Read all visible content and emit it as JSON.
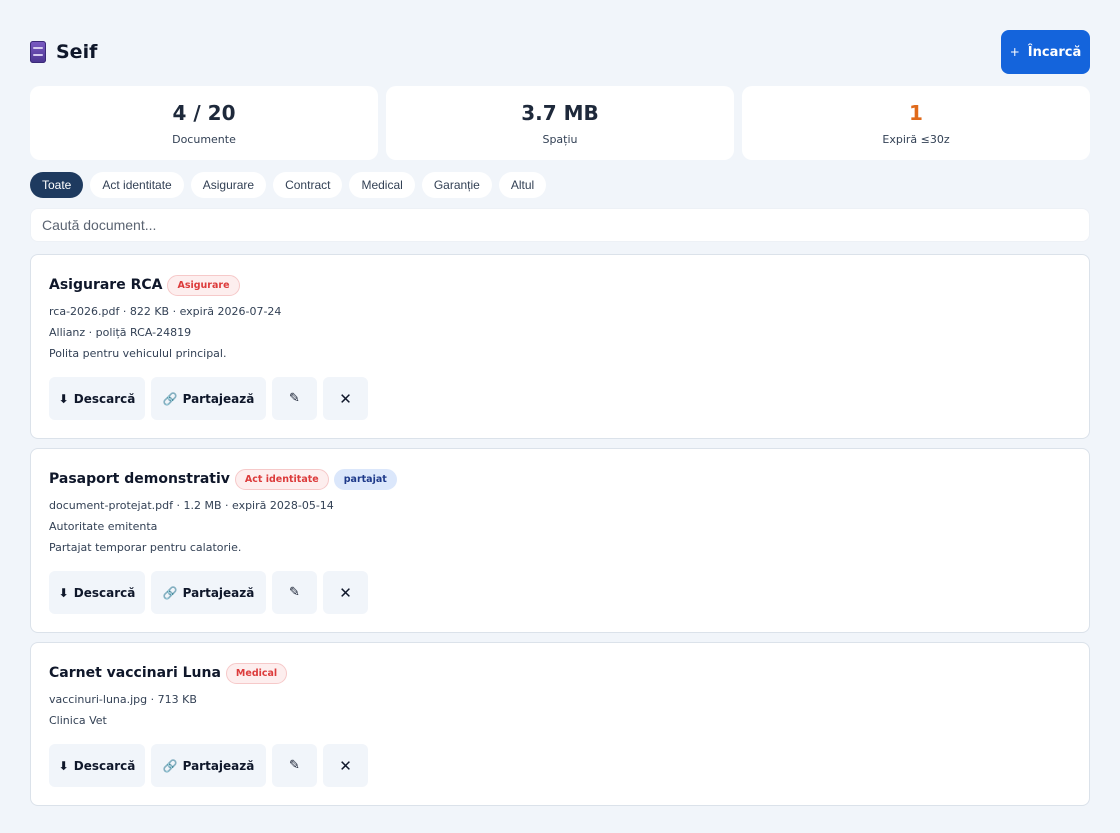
{
  "header": {
    "title": "Seif",
    "upload_label": "Încarcă",
    "upload_icon": "plus-icon",
    "vault_icon": "vault-icon"
  },
  "stats": [
    {
      "value": "4 / 20",
      "label": "Documente"
    },
    {
      "value": "3.7 MB",
      "label": "Spațiu"
    },
    {
      "value": "1",
      "label": "Expiră ≤30z",
      "color": "#e06a1a"
    }
  ],
  "filters": [
    "Toate",
    "Act identitate",
    "Asigurare",
    "Contract",
    "Medical",
    "Garanție",
    "Altul"
  ],
  "active_filter": "Toate",
  "search": {
    "placeholder": "Caută document..."
  },
  "actions": {
    "download": "Descarcă",
    "share": "Partajează",
    "edit": "✎",
    "delete": "✕"
  },
  "documents": [
    {
      "title": "Asigurare RCA",
      "category": "Asigurare",
      "file": "rca-2026.pdf · 822 KB · expiră 2026-07-24",
      "issuer": "Allianz · poliță RCA-24819",
      "note": "Polita pentru vehiculul principal."
    },
    {
      "title": "Pasaport demonstrativ",
      "category": "Act identitate",
      "shared": "partajat",
      "file": "document-protejat.pdf · 1.2 MB · expiră 2028-05-14",
      "issuer": "Autoritate emitenta",
      "note": "Partajat temporar pentru calatorie."
    },
    {
      "title": "Carnet vaccinari Luna",
      "category": "Medical",
      "file": "vaccinuri-luna.jpg · 713 KB",
      "issuer": "Clinica Vet"
    }
  ],
  "colors": {
    "accent": "#1464dc",
    "active_chip": "#1e3a5f",
    "badge_red": "#dc3b3b",
    "badge_shared": "#1e3a8a"
  }
}
